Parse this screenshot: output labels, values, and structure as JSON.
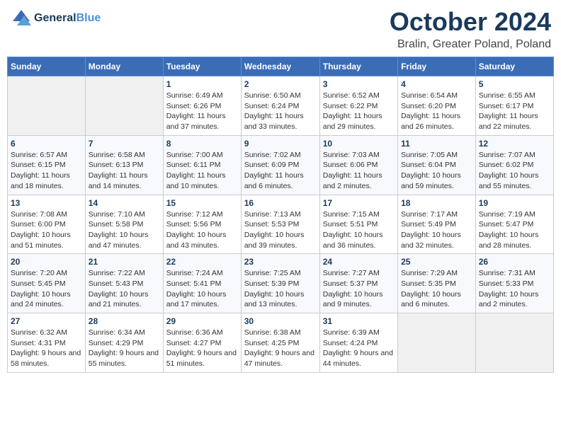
{
  "logo": {
    "line1": "General",
    "line2": "Blue"
  },
  "title": "October 2024",
  "subtitle": "Bralin, Greater Poland, Poland",
  "weekdays": [
    "Sunday",
    "Monday",
    "Tuesday",
    "Wednesday",
    "Thursday",
    "Friday",
    "Saturday"
  ],
  "weeks": [
    [
      {
        "day": "",
        "detail": ""
      },
      {
        "day": "",
        "detail": ""
      },
      {
        "day": "1",
        "detail": "Sunrise: 6:49 AM\nSunset: 6:26 PM\nDaylight: 11 hours and 37 minutes."
      },
      {
        "day": "2",
        "detail": "Sunrise: 6:50 AM\nSunset: 6:24 PM\nDaylight: 11 hours and 33 minutes."
      },
      {
        "day": "3",
        "detail": "Sunrise: 6:52 AM\nSunset: 6:22 PM\nDaylight: 11 hours and 29 minutes."
      },
      {
        "day": "4",
        "detail": "Sunrise: 6:54 AM\nSunset: 6:20 PM\nDaylight: 11 hours and 26 minutes."
      },
      {
        "day": "5",
        "detail": "Sunrise: 6:55 AM\nSunset: 6:17 PM\nDaylight: 11 hours and 22 minutes."
      }
    ],
    [
      {
        "day": "6",
        "detail": "Sunrise: 6:57 AM\nSunset: 6:15 PM\nDaylight: 11 hours and 18 minutes."
      },
      {
        "day": "7",
        "detail": "Sunrise: 6:58 AM\nSunset: 6:13 PM\nDaylight: 11 hours and 14 minutes."
      },
      {
        "day": "8",
        "detail": "Sunrise: 7:00 AM\nSunset: 6:11 PM\nDaylight: 11 hours and 10 minutes."
      },
      {
        "day": "9",
        "detail": "Sunrise: 7:02 AM\nSunset: 6:09 PM\nDaylight: 11 hours and 6 minutes."
      },
      {
        "day": "10",
        "detail": "Sunrise: 7:03 AM\nSunset: 6:06 PM\nDaylight: 11 hours and 2 minutes."
      },
      {
        "day": "11",
        "detail": "Sunrise: 7:05 AM\nSunset: 6:04 PM\nDaylight: 10 hours and 59 minutes."
      },
      {
        "day": "12",
        "detail": "Sunrise: 7:07 AM\nSunset: 6:02 PM\nDaylight: 10 hours and 55 minutes."
      }
    ],
    [
      {
        "day": "13",
        "detail": "Sunrise: 7:08 AM\nSunset: 6:00 PM\nDaylight: 10 hours and 51 minutes."
      },
      {
        "day": "14",
        "detail": "Sunrise: 7:10 AM\nSunset: 5:58 PM\nDaylight: 10 hours and 47 minutes."
      },
      {
        "day": "15",
        "detail": "Sunrise: 7:12 AM\nSunset: 5:56 PM\nDaylight: 10 hours and 43 minutes."
      },
      {
        "day": "16",
        "detail": "Sunrise: 7:13 AM\nSunset: 5:53 PM\nDaylight: 10 hours and 39 minutes."
      },
      {
        "day": "17",
        "detail": "Sunrise: 7:15 AM\nSunset: 5:51 PM\nDaylight: 10 hours and 36 minutes."
      },
      {
        "day": "18",
        "detail": "Sunrise: 7:17 AM\nSunset: 5:49 PM\nDaylight: 10 hours and 32 minutes."
      },
      {
        "day": "19",
        "detail": "Sunrise: 7:19 AM\nSunset: 5:47 PM\nDaylight: 10 hours and 28 minutes."
      }
    ],
    [
      {
        "day": "20",
        "detail": "Sunrise: 7:20 AM\nSunset: 5:45 PM\nDaylight: 10 hours and 24 minutes."
      },
      {
        "day": "21",
        "detail": "Sunrise: 7:22 AM\nSunset: 5:43 PM\nDaylight: 10 hours and 21 minutes."
      },
      {
        "day": "22",
        "detail": "Sunrise: 7:24 AM\nSunset: 5:41 PM\nDaylight: 10 hours and 17 minutes."
      },
      {
        "day": "23",
        "detail": "Sunrise: 7:25 AM\nSunset: 5:39 PM\nDaylight: 10 hours and 13 minutes."
      },
      {
        "day": "24",
        "detail": "Sunrise: 7:27 AM\nSunset: 5:37 PM\nDaylight: 10 hours and 9 minutes."
      },
      {
        "day": "25",
        "detail": "Sunrise: 7:29 AM\nSunset: 5:35 PM\nDaylight: 10 hours and 6 minutes."
      },
      {
        "day": "26",
        "detail": "Sunrise: 7:31 AM\nSunset: 5:33 PM\nDaylight: 10 hours and 2 minutes."
      }
    ],
    [
      {
        "day": "27",
        "detail": "Sunrise: 6:32 AM\nSunset: 4:31 PM\nDaylight: 9 hours and 58 minutes."
      },
      {
        "day": "28",
        "detail": "Sunrise: 6:34 AM\nSunset: 4:29 PM\nDaylight: 9 hours and 55 minutes."
      },
      {
        "day": "29",
        "detail": "Sunrise: 6:36 AM\nSunset: 4:27 PM\nDaylight: 9 hours and 51 minutes."
      },
      {
        "day": "30",
        "detail": "Sunrise: 6:38 AM\nSunset: 4:25 PM\nDaylight: 9 hours and 47 minutes."
      },
      {
        "day": "31",
        "detail": "Sunrise: 6:39 AM\nSunset: 4:24 PM\nDaylight: 9 hours and 44 minutes."
      },
      {
        "day": "",
        "detail": ""
      },
      {
        "day": "",
        "detail": ""
      }
    ]
  ]
}
